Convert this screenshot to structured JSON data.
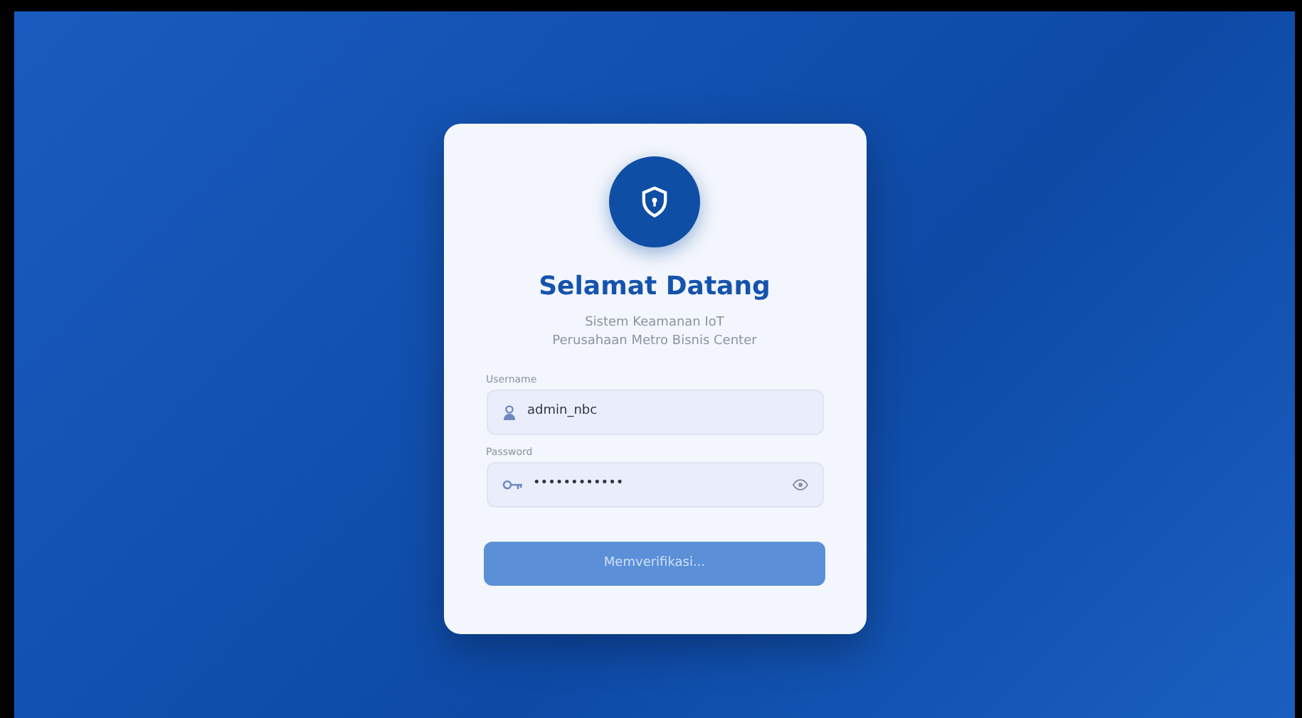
{
  "card": {
    "title": "Selamat Datang",
    "subtitle_lines": [
      "Sistem Keamanan IoT",
      "Perusahaan Metro Bisnis Center"
    ]
  },
  "fields": [
    {
      "kind": "text",
      "label": "Username",
      "value": "admin_nbc"
    },
    {
      "kind": "password",
      "label": "Password",
      "value": "••••••••••••"
    }
  ],
  "submit": {
    "label": "Memverifikasi...",
    "disabled": true
  }
}
